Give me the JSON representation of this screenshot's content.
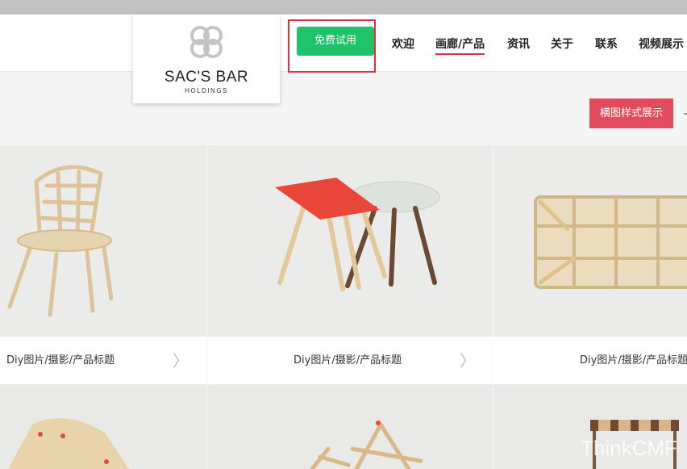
{
  "header": {
    "logo": {
      "name": "SAC'S BAR",
      "sub": "HOLDINGS"
    },
    "trial_button": "免费试用",
    "nav": [
      {
        "label": "欢迎",
        "active": false
      },
      {
        "label": "画廊/产品",
        "active": true
      },
      {
        "label": "资讯",
        "active": false
      },
      {
        "label": "关于",
        "active": false
      },
      {
        "label": "联系",
        "active": false
      },
      {
        "label": "视频展示",
        "active": false
      }
    ]
  },
  "toolbar": {
    "view_button": "横图样式展示"
  },
  "products": [
    {
      "title": "Diy图片/摄影/产品标题",
      "chevron": "〉",
      "image": "wooden-chair"
    },
    {
      "title": "Diy图片/摄影/产品标题",
      "chevron": "〉",
      "image": "side-tables"
    },
    {
      "title": "Diy图片/摄影/产品标题",
      "chevron": "〉",
      "image": "shelf-table"
    }
  ],
  "row2_images": [
    "bent-plywood-seat",
    "stick-frame",
    "striped-stool"
  ],
  "watermark": "ThinkCMF",
  "colors": {
    "accent_red": "#e0303a",
    "trial_green": "#1ec36a",
    "view_button": "#e24c5d"
  }
}
